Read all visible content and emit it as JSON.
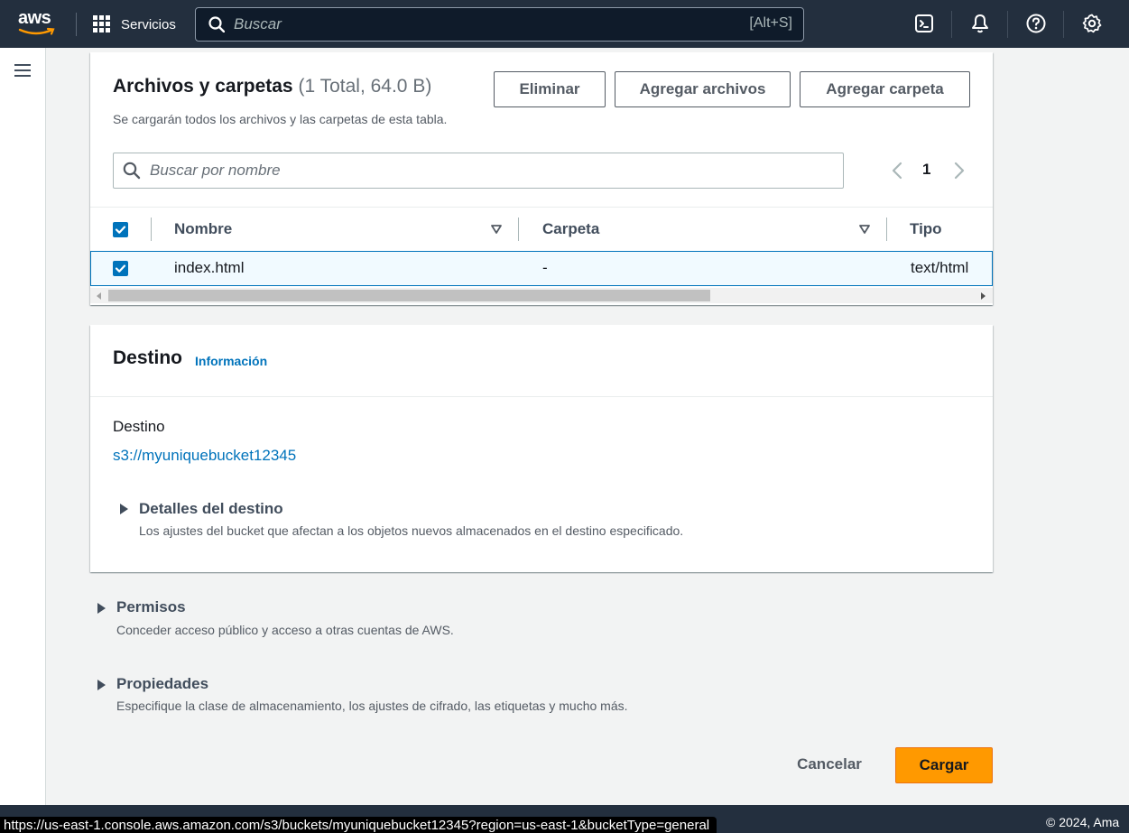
{
  "topnav": {
    "logo_text": "aws",
    "services_label": "Servicios",
    "search_placeholder": "Buscar",
    "search_shortcut": "[Alt+S]",
    "bg_color": "#232f3e",
    "icons": [
      "cloudshell-icon",
      "bell-icon",
      "help-icon",
      "settings-icon"
    ]
  },
  "files": {
    "title": "Archivos y carpetas",
    "count": "(1 Total, 64.0 B)",
    "description": "Se cargarán todos los archivos y las carpetas de esta tabla.",
    "buttons": {
      "delete": "Eliminar",
      "add_files": "Agregar archivos",
      "add_folder": "Agregar carpeta"
    },
    "filter_placeholder": "Buscar por nombre",
    "page": "1",
    "columns": [
      "Nombre",
      "Carpeta",
      "Tipo"
    ],
    "rows": [
      {
        "name": "index.html",
        "folder": "-",
        "type": "text/html",
        "selected": true
      }
    ]
  },
  "destination": {
    "title": "Destino",
    "info_link": "Información",
    "label": "Destino",
    "bucket_url": "s3://myuniquebucket12345",
    "details_title": "Detalles del destino",
    "details_desc": "Los ajustes del bucket que afectan a los objetos nuevos almacenados en el destino especificado."
  },
  "permissions": {
    "title": "Permisos",
    "desc": "Conceder acceso público y acceso a otras cuentas de AWS."
  },
  "properties": {
    "title": "Propiedades",
    "desc": "Especifique la clase de almacenamiento, los ajustes de cifrado, las etiquetas y mucho más."
  },
  "actions": {
    "cancel": "Cancelar",
    "upload": "Cargar",
    "primary_color": "#ff9900"
  },
  "status_bar": {
    "url": "https://us-east-1.console.aws.amazon.com/s3/buckets/myuniquebucket12345?region=us-east-1&bucketType=general"
  },
  "footer": {
    "copyright": "© 2024, Ama"
  }
}
